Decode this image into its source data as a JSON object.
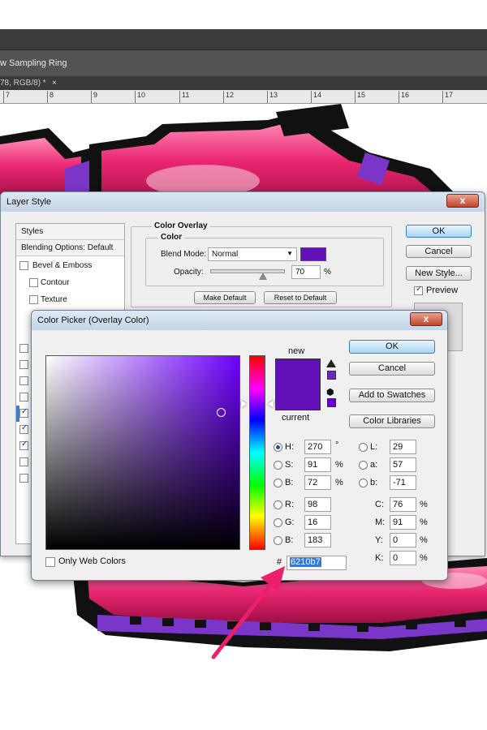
{
  "app": {
    "options_bar_text": "w Sampling Ring",
    "doc_tab": "78, RGB/8) *",
    "doc_tab_close": "×",
    "ruler_marks": [
      "7",
      "8",
      "9",
      "10",
      "11",
      "12",
      "13",
      "14",
      "15",
      "16",
      "17"
    ]
  },
  "layer_style": {
    "title": "Layer Style",
    "close": "x",
    "styles_header": "Styles",
    "blending_options": "Blending Options: Default",
    "items": [
      {
        "label": "Bevel & Emboss",
        "checked": false
      },
      {
        "label": "Contour",
        "checked": false
      },
      {
        "label": "Texture",
        "checked": false
      }
    ],
    "color_overlay": {
      "section_title": "Color Overlay",
      "group_title": "Color",
      "blend_mode_label": "Blend Mode:",
      "blend_mode_value": "Normal",
      "swatch_color": "#6210b7",
      "opacity_label": "Opacity:",
      "opacity_value": "70",
      "opacity_unit": "%",
      "opacity_level": 0.7,
      "make_default": "Make Default",
      "reset_default": "Reset to Default"
    },
    "buttons": {
      "ok": "OK",
      "cancel": "Cancel",
      "new_style": "New Style...",
      "preview": "Preview"
    }
  },
  "color_picker": {
    "title": "Color Picker (Overlay Color)",
    "close": "x",
    "new_label": "new",
    "current_label": "current",
    "new_color": "#6210b7",
    "current_color": "#6210b7",
    "buttons": {
      "ok": "OK",
      "cancel": "Cancel",
      "add_swatches": "Add to Swatches",
      "color_libraries": "Color Libraries"
    },
    "hsb": {
      "h": "270",
      "h_unit": "°",
      "s": "91",
      "s_unit": "%",
      "b": "72",
      "b_unit": "%"
    },
    "rgb": {
      "r": "98",
      "g": "16",
      "b": "183"
    },
    "lab": {
      "l": "29",
      "a": "57",
      "b": "-71"
    },
    "cmyk": {
      "c": "76",
      "m": "91",
      "y": "0",
      "k": "0",
      "unit": "%"
    },
    "labels": {
      "h": "H:",
      "s": "S:",
      "b": "B:",
      "r": "R:",
      "g": "G:",
      "bb": "B:",
      "l": "L:",
      "a": "a:",
      "lb": "b:",
      "c": "C:",
      "m": "M:",
      "y": "Y:",
      "k": "K:"
    },
    "only_web_colors": "Only Web Colors",
    "hex_prefix": "#",
    "hex_value": "6210b7",
    "selected_mode": "H"
  },
  "colors": {
    "accent_pink": "#e8256c",
    "purple": "#6210b7",
    "arrow": "#ec1f6d"
  }
}
